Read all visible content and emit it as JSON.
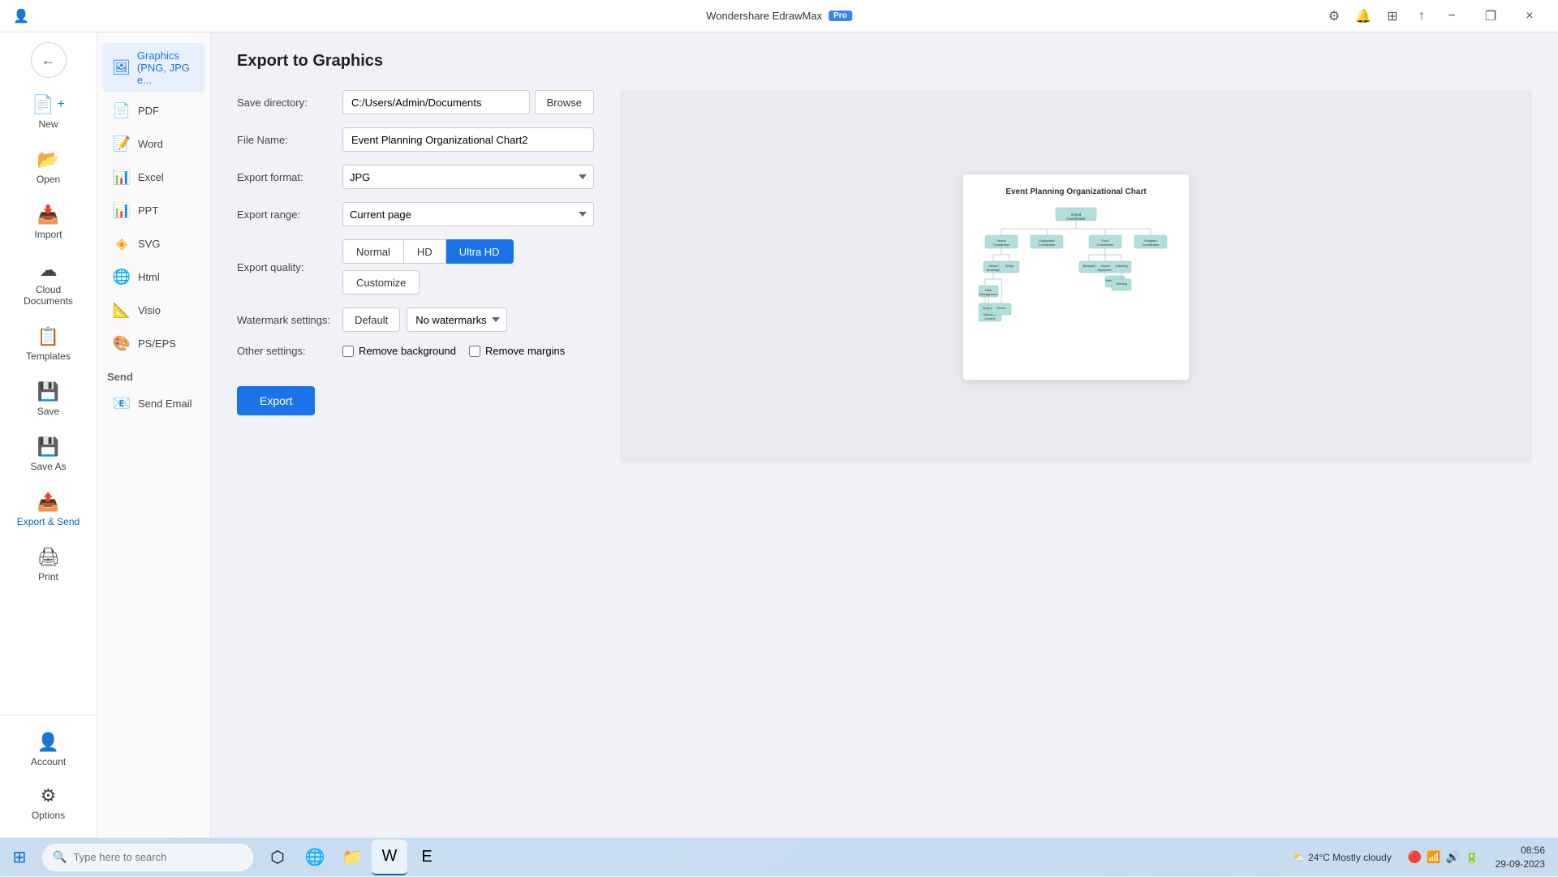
{
  "app": {
    "title": "Wondershare EdrawMax",
    "badge": "Pro"
  },
  "titlebar": {
    "minimize": "−",
    "restore": "❐",
    "close": "×"
  },
  "nav": {
    "back": "←",
    "items": [
      {
        "id": "new",
        "label": "New",
        "icon": "+"
      },
      {
        "id": "open",
        "label": "Open",
        "icon": "📂"
      },
      {
        "id": "import",
        "label": "Import",
        "icon": "📥"
      },
      {
        "id": "cloud",
        "label": "Cloud Documents",
        "icon": "☁"
      },
      {
        "id": "templates",
        "label": "Templates",
        "icon": "📋"
      },
      {
        "id": "save",
        "label": "Save",
        "icon": "💾"
      },
      {
        "id": "saveas",
        "label": "Save As",
        "icon": "💾"
      },
      {
        "id": "export",
        "label": "Export & Send",
        "icon": "📤"
      },
      {
        "id": "print",
        "label": "Print",
        "icon": "🖨"
      }
    ],
    "bottom": [
      {
        "id": "account",
        "label": "Account",
        "icon": "👤"
      },
      {
        "id": "options",
        "label": "Options",
        "icon": "⚙"
      }
    ]
  },
  "sidebar": {
    "export_items": [
      {
        "id": "graphics",
        "label": "Graphics (PNG, JPG e...",
        "icon": "🖼",
        "active": true
      },
      {
        "id": "pdf",
        "label": "PDF",
        "icon": "📄"
      },
      {
        "id": "word",
        "label": "Word",
        "icon": "📝"
      },
      {
        "id": "excel",
        "label": "Excel",
        "icon": "📊"
      },
      {
        "id": "ppt",
        "label": "PPT",
        "icon": "📊"
      },
      {
        "id": "svg",
        "label": "SVG",
        "icon": "🔷"
      },
      {
        "id": "html",
        "label": "Html",
        "icon": "🌐"
      },
      {
        "id": "visio",
        "label": "Visio",
        "icon": "📐"
      },
      {
        "id": "pseps",
        "label": "PS/EPS",
        "icon": "🎨"
      }
    ],
    "send_label": "Send",
    "send_items": [
      {
        "id": "email",
        "label": "Send Email",
        "icon": "📧"
      }
    ]
  },
  "export": {
    "title": "Export to Graphics",
    "fields": {
      "save_directory_label": "Save directory:",
      "save_directory_value": "C:/Users/Admin/Documents",
      "browse_label": "Browse",
      "file_name_label": "File Name:",
      "file_name_value": "Event Planning Organizational Chart2",
      "export_format_label": "Export format:",
      "export_format_value": "JPG",
      "export_range_label": "Export range:",
      "export_range_value": "Current page",
      "export_quality_label": "Export quality:",
      "quality_options": [
        "Normal",
        "HD",
        "Ultra HD"
      ],
      "quality_selected": "Ultra HD",
      "customize_label": "Customize",
      "watermark_label": "Watermark settings:",
      "watermark_default": "Default",
      "watermark_value": "No watermarks",
      "other_settings_label": "Other settings:",
      "remove_background_label": "Remove background",
      "remove_margins_label": "Remove margins",
      "export_button": "Export"
    },
    "preview": {
      "chart_title": "Event Planning Organizational Chart"
    }
  },
  "taskbar": {
    "search_placeholder": "Type here to search",
    "time": "08:56",
    "date": "29-09-2023",
    "weather": "24°C  Mostly cloudy"
  }
}
